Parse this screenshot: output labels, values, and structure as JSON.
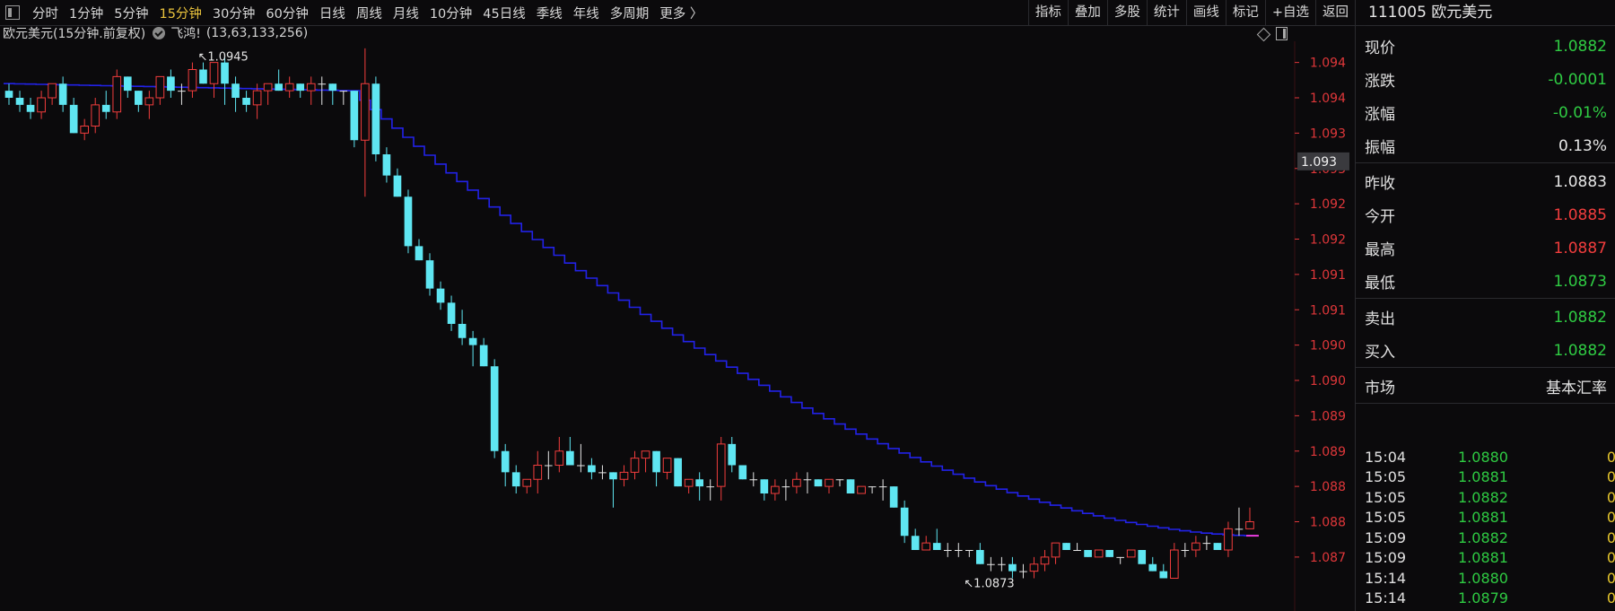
{
  "toolbar": {
    "periods": [
      "分时",
      "1分钟",
      "5分钟",
      "15分钟",
      "30分钟",
      "60分钟",
      "日线",
      "周线",
      "月线",
      "10分钟",
      "45日线",
      "季线",
      "年线",
      "多周期",
      "更多 〉"
    ],
    "active_period": "15分钟",
    "tools": [
      "指标",
      "叠加",
      "多股",
      "统计",
      "画线",
      "标记",
      "+自选",
      "返回"
    ]
  },
  "info": {
    "title": "欧元美元(15分钟.前复权)",
    "indicator": "飞鸿!",
    "params": "(13,63,133,256)"
  },
  "colors": {
    "up": "#f23d3d",
    "down": "#5fe6f2",
    "ma": "#2222e8",
    "ma_last": "#e83cdc",
    "axis_label": "#e0373a",
    "green": "#2fcc43",
    "yellow": "#e6c62c"
  },
  "chart_data": {
    "type": "candlestick",
    "ylim": [
      1.0868,
      1.0948
    ],
    "y_ticks": [
      "1.094",
      "1.094",
      "1.093",
      "1.093",
      "1.092",
      "1.092",
      "1.091",
      "1.091",
      "1.090",
      "1.090",
      "1.089",
      "1.089",
      "1.088",
      "1.088",
      "1.087"
    ],
    "y_tick_values": [
      1.0945,
      1.094,
      1.0935,
      1.093,
      1.0925,
      1.092,
      1.0915,
      1.091,
      1.0905,
      1.09,
      1.0895,
      1.089,
      1.0885,
      1.088,
      1.0875
    ],
    "cursor_label": "1.093",
    "cursor_value": 1.0931,
    "annotations": [
      {
        "text": "1.0945",
        "value": 1.0945,
        "bar": 17
      },
      {
        "text": "1.0873",
        "value": 1.0873,
        "bar": 88
      }
    ],
    "candles": [
      [
        1.0941,
        1.0942,
        1.0939,
        1.094
      ],
      [
        1.094,
        1.0941,
        1.0938,
        1.0939
      ],
      [
        1.0939,
        1.094,
        1.0937,
        1.0938
      ],
      [
        1.0938,
        1.0941,
        1.0937,
        1.094
      ],
      [
        1.094,
        1.0942,
        1.0939,
        1.0942
      ],
      [
        1.0942,
        1.0943,
        1.0938,
        1.0939
      ],
      [
        1.0939,
        1.094,
        1.0935,
        1.0935
      ],
      [
        1.0935,
        1.0937,
        1.0934,
        1.0936
      ],
      [
        1.0936,
        1.094,
        1.0935,
        1.0939
      ],
      [
        1.0939,
        1.0941,
        1.0937,
        1.0938
      ],
      [
        1.0938,
        1.0944,
        1.0937,
        1.0943
      ],
      [
        1.0943,
        1.0943,
        1.094,
        1.0941
      ],
      [
        1.0941,
        1.0941,
        1.0938,
        1.0939
      ],
      [
        1.0939,
        1.0941,
        1.0937,
        1.094
      ],
      [
        1.094,
        1.0943,
        1.0939,
        1.0943
      ],
      [
        1.0943,
        1.0944,
        1.094,
        1.0941
      ],
      [
        1.0941,
        1.0942,
        1.0939,
        1.0941
      ],
      [
        1.0941,
        1.0945,
        1.094,
        1.0944
      ],
      [
        1.0944,
        1.0945,
        1.0942,
        1.0942
      ],
      [
        1.0942,
        1.0945,
        1.094,
        1.0945
      ],
      [
        1.0945,
        1.0946,
        1.0939,
        1.0942
      ],
      [
        1.0942,
        1.0943,
        1.0938,
        1.094
      ],
      [
        1.094,
        1.0941,
        1.0938,
        1.0939
      ],
      [
        1.0939,
        1.0942,
        1.0937,
        1.0941
      ],
      [
        1.0941,
        1.0942,
        1.0939,
        1.0942
      ],
      [
        1.0942,
        1.0944,
        1.0941,
        1.0941
      ],
      [
        1.0941,
        1.0943,
        1.094,
        1.0942
      ],
      [
        1.0942,
        1.0942,
        1.094,
        1.0941
      ],
      [
        1.0941,
        1.0943,
        1.0939,
        1.0942
      ],
      [
        1.0942,
        1.0943,
        1.0939,
        1.0942
      ],
      [
        1.0942,
        1.0942,
        1.0939,
        1.0941
      ],
      [
        1.0941,
        1.0941,
        1.0939,
        1.0941
      ],
      [
        1.0941,
        1.0941,
        1.0933,
        1.0934
      ],
      [
        1.0934,
        1.0947,
        1.0926,
        1.0942
      ],
      [
        1.0942,
        1.0943,
        1.0931,
        1.0932
      ],
      [
        1.0932,
        1.0933,
        1.0928,
        1.0929
      ],
      [
        1.0929,
        1.093,
        1.0926,
        1.0926
      ],
      [
        1.0926,
        1.0927,
        1.0918,
        1.0919
      ],
      [
        1.0919,
        1.092,
        1.0917,
        1.0917
      ],
      [
        1.0917,
        1.0918,
        1.0912,
        1.0913
      ],
      [
        1.0913,
        1.0914,
        1.091,
        1.0911
      ],
      [
        1.0911,
        1.0912,
        1.0907,
        1.0908
      ],
      [
        1.0908,
        1.091,
        1.0905,
        1.0906
      ],
      [
        1.0906,
        1.0907,
        1.0902,
        1.0905
      ],
      [
        1.0905,
        1.0906,
        1.0902,
        1.0902
      ],
      [
        1.0902,
        1.0903,
        1.0889,
        1.089
      ],
      [
        1.089,
        1.0891,
        1.0885,
        1.0887
      ],
      [
        1.0887,
        1.0888,
        1.0884,
        1.0885
      ],
      [
        1.0885,
        1.0886,
        1.0884,
        1.0886
      ],
      [
        1.0886,
        1.089,
        1.0884,
        1.0888
      ],
      [
        1.0888,
        1.089,
        1.0886,
        1.0888
      ],
      [
        1.0888,
        1.0892,
        1.0887,
        1.089
      ],
      [
        1.089,
        1.0892,
        1.0889,
        1.0888
      ],
      [
        1.0888,
        1.0891,
        1.0887,
        1.0888
      ],
      [
        1.0888,
        1.0889,
        1.0886,
        1.0887
      ],
      [
        1.0887,
        1.0888,
        1.0886,
        1.0887
      ],
      [
        1.0887,
        1.0887,
        1.0882,
        1.0886
      ],
      [
        1.0886,
        1.0888,
        1.0885,
        1.0887
      ],
      [
        1.0887,
        1.089,
        1.0886,
        1.0889
      ],
      [
        1.0889,
        1.089,
        1.0887,
        1.089
      ],
      [
        1.089,
        1.089,
        1.0885,
        1.0887
      ],
      [
        1.0887,
        1.0889,
        1.0886,
        1.0889
      ],
      [
        1.0889,
        1.0889,
        1.0885,
        1.0885
      ],
      [
        1.0885,
        1.0886,
        1.0884,
        1.0886
      ],
      [
        1.0886,
        1.0887,
        1.0883,
        1.0885
      ],
      [
        1.0885,
        1.0886,
        1.0883,
        1.0885
      ],
      [
        1.0885,
        1.0892,
        1.0883,
        1.0891
      ],
      [
        1.0891,
        1.0892,
        1.0887,
        1.0888
      ],
      [
        1.0888,
        1.0888,
        1.0886,
        1.0886
      ],
      [
        1.0886,
        1.0887,
        1.0885,
        1.0886
      ],
      [
        1.0886,
        1.0886,
        1.0883,
        1.0884
      ],
      [
        1.0884,
        1.0886,
        1.0883,
        1.0885
      ],
      [
        1.0885,
        1.0886,
        1.0883,
        1.0885
      ],
      [
        1.0885,
        1.0887,
        1.0884,
        1.0886
      ],
      [
        1.0886,
        1.0887,
        1.0884,
        1.0886
      ],
      [
        1.0886,
        1.0886,
        1.0885,
        1.0885
      ],
      [
        1.0885,
        1.0886,
        1.0884,
        1.0886
      ],
      [
        1.0886,
        1.0886,
        1.0885,
        1.0886
      ],
      [
        1.0886,
        1.0886,
        1.0884,
        1.0884
      ],
      [
        1.0884,
        1.0885,
        1.0884,
        1.0885
      ],
      [
        1.0885,
        1.0885,
        1.0884,
        1.0885
      ],
      [
        1.0885,
        1.0886,
        1.0883,
        1.0885
      ],
      [
        1.0885,
        1.0885,
        1.0882,
        1.0882
      ],
      [
        1.0882,
        1.0883,
        1.0877,
        1.0878
      ],
      [
        1.0878,
        1.0879,
        1.0876,
        1.0876
      ],
      [
        1.0876,
        1.0878,
        1.0876,
        1.0877
      ],
      [
        1.0877,
        1.0879,
        1.0876,
        1.0876
      ],
      [
        1.0876,
        1.0877,
        1.0875,
        1.0876
      ],
      [
        1.0876,
        1.0877,
        1.0875,
        1.0876
      ],
      [
        1.0876,
        1.0876,
        1.0875,
        1.0876
      ],
      [
        1.0876,
        1.0877,
        1.0874,
        1.0874
      ],
      [
        1.0874,
        1.0875,
        1.0873,
        1.0874
      ],
      [
        1.0874,
        1.0875,
        1.0873,
        1.0874
      ],
      [
        1.0874,
        1.0875,
        1.0872,
        1.0873
      ],
      [
        1.0873,
        1.0874,
        1.0872,
        1.0873
      ],
      [
        1.0873,
        1.0875,
        1.0872,
        1.0874
      ],
      [
        1.0874,
        1.0876,
        1.0873,
        1.0875
      ],
      [
        1.0875,
        1.0877,
        1.0874,
        1.0877
      ],
      [
        1.0877,
        1.0877,
        1.0876,
        1.0876
      ],
      [
        1.0876,
        1.0877,
        1.0876,
        1.0876
      ],
      [
        1.0876,
        1.0876,
        1.0875,
        1.0875
      ],
      [
        1.0875,
        1.0876,
        1.0875,
        1.0876
      ],
      [
        1.0876,
        1.0876,
        1.0875,
        1.0875
      ],
      [
        1.0875,
        1.0875,
        1.0874,
        1.0875
      ],
      [
        1.0875,
        1.0876,
        1.0875,
        1.0876
      ],
      [
        1.0876,
        1.0876,
        1.0874,
        1.0874
      ],
      [
        1.0874,
        1.0875,
        1.0873,
        1.0873
      ],
      [
        1.0873,
        1.0874,
        1.0872,
        1.0872
      ],
      [
        1.0872,
        1.0877,
        1.0872,
        1.0876
      ],
      [
        1.0876,
        1.0877,
        1.0875,
        1.0876
      ],
      [
        1.0876,
        1.0878,
        1.0875,
        1.0877
      ],
      [
        1.0877,
        1.0878,
        1.0876,
        1.0877
      ],
      [
        1.0877,
        1.0877,
        1.0876,
        1.0876
      ],
      [
        1.0876,
        1.088,
        1.0875,
        1.0879
      ],
      [
        1.0879,
        1.0882,
        1.0878,
        1.0879
      ],
      [
        1.0879,
        1.0882,
        1.0879,
        1.088
      ]
    ],
    "ma": {
      "start": 1.0941,
      "flat_until": 32,
      "decay_end": 1.0878,
      "color": "#2222e8"
    }
  },
  "panel": {
    "title": "111005 欧元美元",
    "quote": [
      {
        "label": "现价",
        "value": "1.0882",
        "color": "green"
      },
      {
        "label": "涨跌",
        "value": "-0.0001",
        "color": "green"
      },
      {
        "label": "涨幅",
        "value": "-0.01%",
        "color": "green"
      },
      {
        "label": "振幅",
        "value": "0.13%",
        "color": "white"
      }
    ],
    "ohlc": [
      {
        "label": "昨收",
        "value": "1.0883",
        "color": "white"
      },
      {
        "label": "今开",
        "value": "1.0885",
        "color": "red"
      },
      {
        "label": "最高",
        "value": "1.0887",
        "color": "red"
      },
      {
        "label": "最低",
        "value": "1.0873",
        "color": "green"
      }
    ],
    "bidask": [
      {
        "label": "卖出",
        "value": "1.0882",
        "color": "green"
      },
      {
        "label": "买入",
        "value": "1.0882",
        "color": "green"
      }
    ],
    "market": {
      "label": "市场",
      "value": "基本汇率"
    },
    "ticks": [
      {
        "time": "15:04",
        "price": "1.0880",
        "vol": "0"
      },
      {
        "time": "15:05",
        "price": "1.0881",
        "vol": "0"
      },
      {
        "time": "15:05",
        "price": "1.0882",
        "vol": "0"
      },
      {
        "time": "15:05",
        "price": "1.0881",
        "vol": "0"
      },
      {
        "time": "15:09",
        "price": "1.0882",
        "vol": "0"
      },
      {
        "time": "15:09",
        "price": "1.0881",
        "vol": "0"
      },
      {
        "time": "15:14",
        "price": "1.0880",
        "vol": "0"
      },
      {
        "time": "15:14",
        "price": "1.0879",
        "vol": "0"
      }
    ]
  }
}
